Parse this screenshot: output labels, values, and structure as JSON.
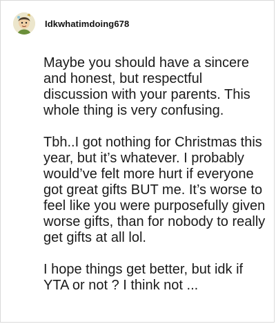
{
  "comment": {
    "username": "Idkwhatimdoing678",
    "avatar_icon": "cartoon-avatar-icon",
    "paragraphs": [
      "Maybe you should have a sincere and honest, but respectful discussion with your parents. This whole thing is very confusing.",
      "Tbh..I got nothing for Christmas this year, but it’s whatever. I probably would’ve felt more hurt if everyone got great gifts BUT me. It’s worse to feel like you were purposefully given worse gifts, than for nobody to really get gifts at all lol.",
      "I hope things get better, but idk if YTA or not ? I think not ..."
    ]
  }
}
